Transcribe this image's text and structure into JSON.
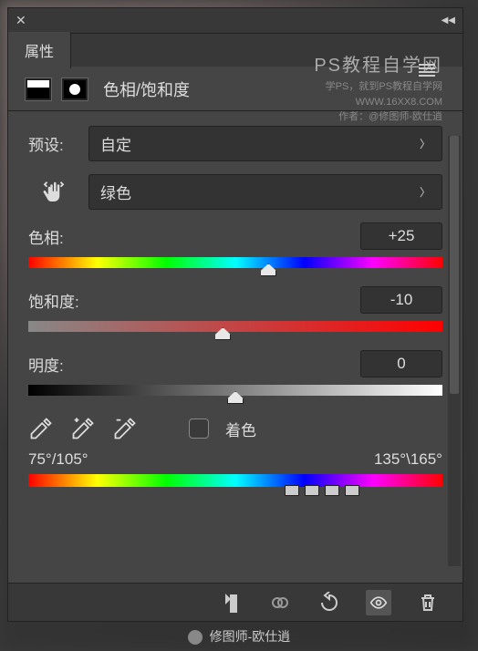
{
  "titlebar": {
    "close": "✕",
    "collapse": "◀◀"
  },
  "tab": {
    "label": "属性"
  },
  "watermark": {
    "title": "PS教程自学网",
    "line1": "学PS，就到PS教程自学网",
    "line2": "WWW.16XX8.COM",
    "line3": "作者：@修图师-欧仕逍"
  },
  "header": {
    "title": "色相/饱和度"
  },
  "preset": {
    "label": "预设:",
    "value": "自定"
  },
  "channel": {
    "value": "绿色"
  },
  "sliders": {
    "hue": {
      "label": "色相:",
      "value": "+25",
      "pos": 58
    },
    "sat": {
      "label": "饱和度:",
      "value": "-10",
      "pos": 47
    },
    "light": {
      "label": "明度:",
      "value": "0",
      "pos": 50
    }
  },
  "colorize": {
    "label": "着色"
  },
  "range": {
    "left": "75°/105°",
    "right": "135°\\165°"
  },
  "footer": {
    "text": "修图师-欧仕逍"
  }
}
